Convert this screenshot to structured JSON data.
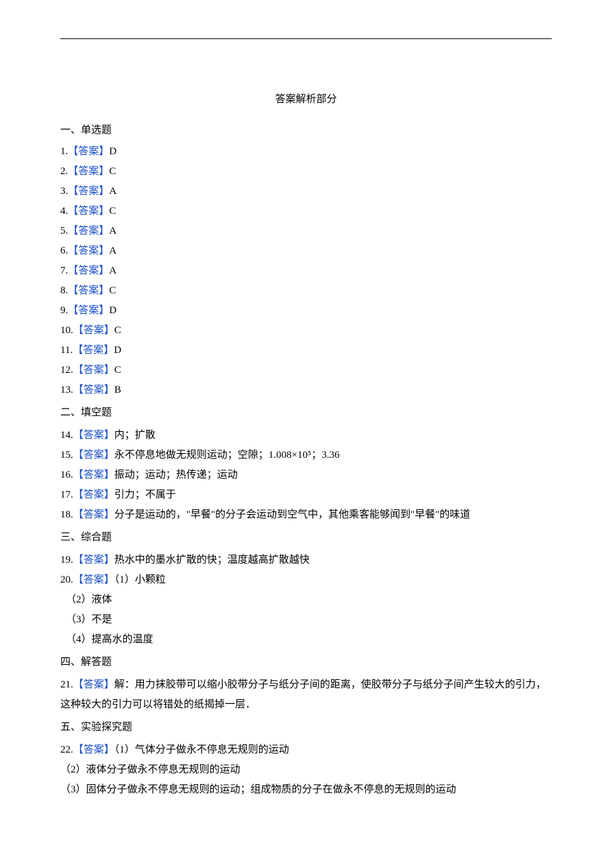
{
  "title": "答案解析部分",
  "sections": {
    "s1": {
      "heading": "一、单选题",
      "items": [
        {
          "num": "1.",
          "tag": "【答案】",
          "val": "D"
        },
        {
          "num": "2.",
          "tag": "【答案】",
          "val": "C"
        },
        {
          "num": "3.",
          "tag": "【答案】",
          "val": "A"
        },
        {
          "num": "4.",
          "tag": "【答案】",
          "val": "C"
        },
        {
          "num": "5.",
          "tag": "【答案】",
          "val": "A"
        },
        {
          "num": "6.",
          "tag": "【答案】",
          "val": "A"
        },
        {
          "num": "7.",
          "tag": "【答案】",
          "val": "A"
        },
        {
          "num": "8.",
          "tag": "【答案】",
          "val": "C"
        },
        {
          "num": "9.",
          "tag": "【答案】",
          "val": "D"
        },
        {
          "num": "10.",
          "tag": "【答案】",
          "val": "C"
        },
        {
          "num": "11.",
          "tag": "【答案】",
          "val": "D"
        },
        {
          "num": "12.",
          "tag": "【答案】",
          "val": "C"
        },
        {
          "num": "13.",
          "tag": "【答案】",
          "val": "B"
        }
      ]
    },
    "s2": {
      "heading": "二、填空题",
      "items": [
        {
          "num": "14.",
          "tag": "【答案】",
          "val": "内；扩散"
        },
        {
          "num": "15.",
          "tag": "【答案】",
          "val": "永不停息地做无规则运动；空隙；1.008×10⁵；3.36"
        },
        {
          "num": "16.",
          "tag": "【答案】",
          "val": "振动；运动；热传递；运动"
        },
        {
          "num": "17.",
          "tag": "【答案】",
          "val": "引力；不属于"
        },
        {
          "num": "18.",
          "tag": "【答案】",
          "val": "分子是运动的，\"早餐\"的分子会运动到空气中，其他乘客能够闻到\"早餐\"的味道"
        }
      ]
    },
    "s3": {
      "heading": "三、综合题",
      "items": [
        {
          "num": "19.",
          "tag": "【答案】",
          "val": "热水中的墨水扩散的快；温度越高扩散越快"
        },
        {
          "num": "20.",
          "tag": "【答案】",
          "val": "（1）小颗粒"
        }
      ],
      "subs": [
        "（2）液体",
        "（3）不是",
        "（4）提高水的温度"
      ]
    },
    "s4": {
      "heading": "四、解答题",
      "items": [
        {
          "num": "21.",
          "tag": "【答案】",
          "val": "解：用力抹胶带可以缩小胶带分子与纸分子间的距离，使胶带分子与纸分子间产生较大的引力，这种较大的引力可以将错处的纸揭掉一层．"
        }
      ]
    },
    "s5": {
      "heading": "五、实验探究题",
      "items": [
        {
          "num": "22.",
          "tag": "【答案】",
          "val": "（1）气体分子做永不停息无规则的运动"
        }
      ],
      "subs": [
        "（2）液体分子做永不停息无规则的运动",
        "（3）固体分子做永不停息无规则的运动；组成物质的分子在做永不停息的无规则的运动"
      ]
    }
  }
}
